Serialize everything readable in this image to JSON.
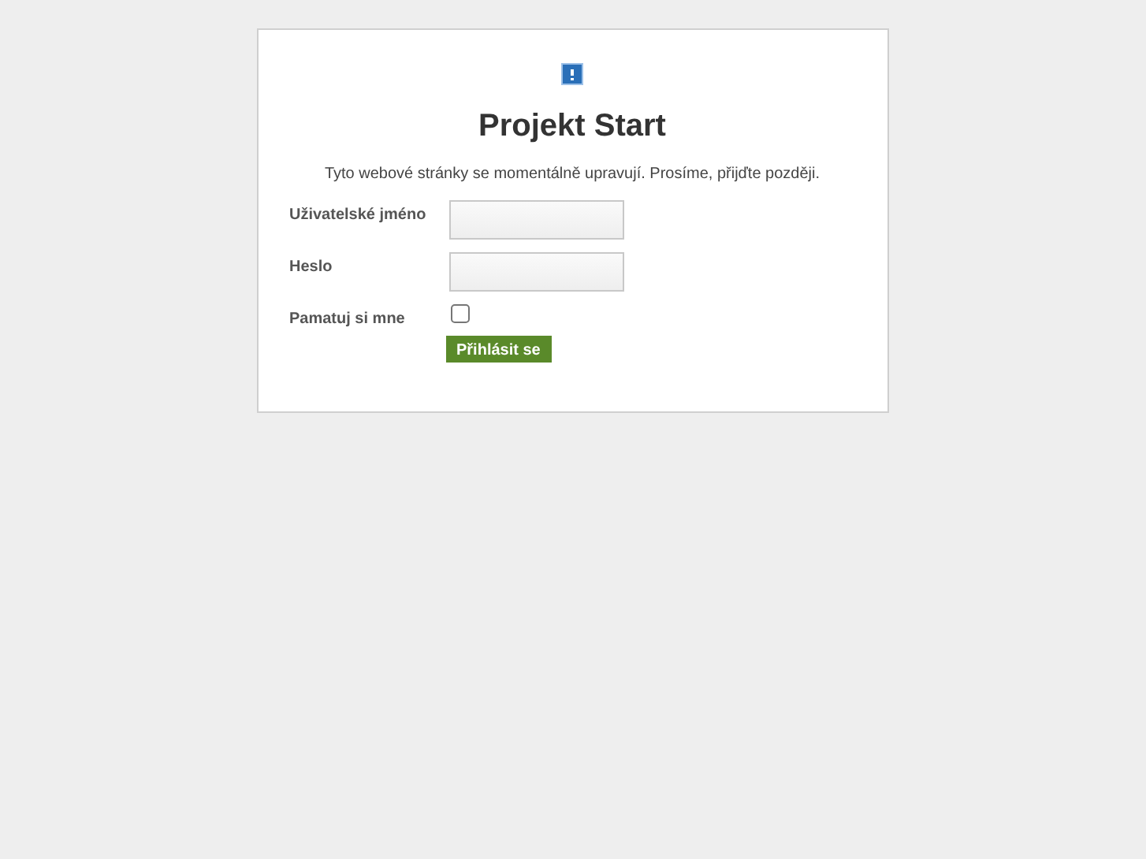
{
  "title": "Projekt Start",
  "message": "Tyto webové stránky se momentálně upravují. Prosíme, přijďte později.",
  "fields": [
    {
      "kind": "text",
      "label": "Uživatelské jméno"
    },
    {
      "kind": "password",
      "label": "Heslo"
    },
    {
      "kind": "checkbox",
      "label": "Pamatuj si mne",
      "checked": false
    }
  ],
  "button": "Přihlásit se"
}
